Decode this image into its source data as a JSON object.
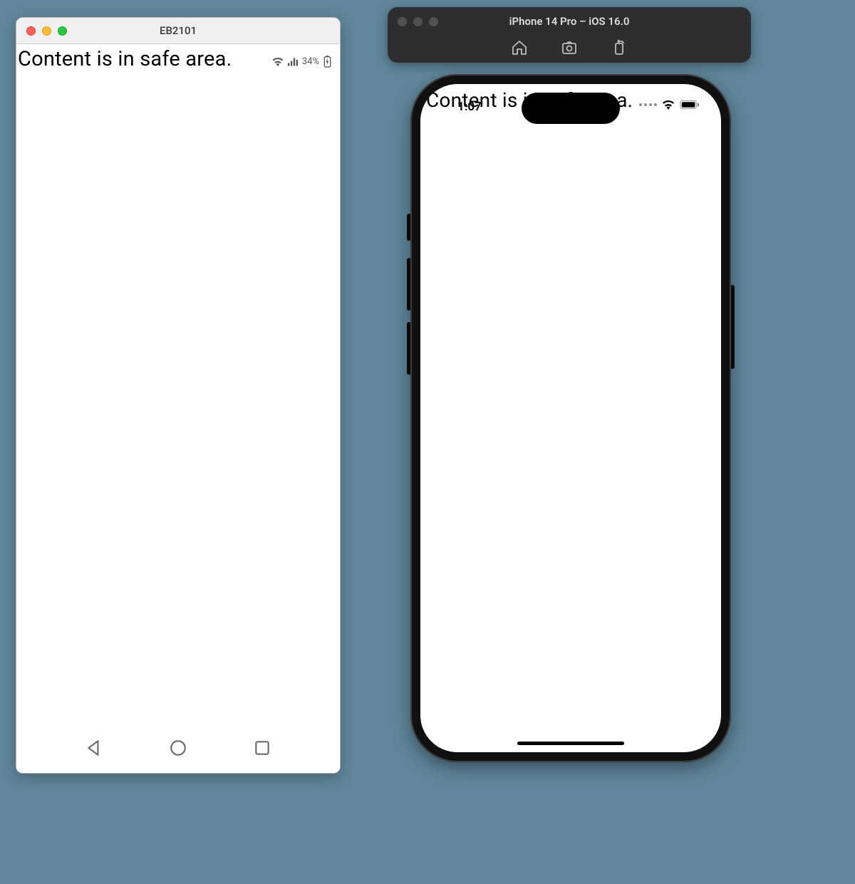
{
  "android": {
    "window_title": "EB2101",
    "content_text": "Content is in safe area.",
    "battery_percent": "34%"
  },
  "ios_toolbar": {
    "title": "iPhone 14 Pro – iOS 16.0",
    "buttons": {
      "home": "home-icon",
      "screenshot": "screenshot-icon",
      "rotate": "rotate-icon"
    }
  },
  "iphone": {
    "content_text": "Content is in safe area.",
    "time": "1:07"
  }
}
